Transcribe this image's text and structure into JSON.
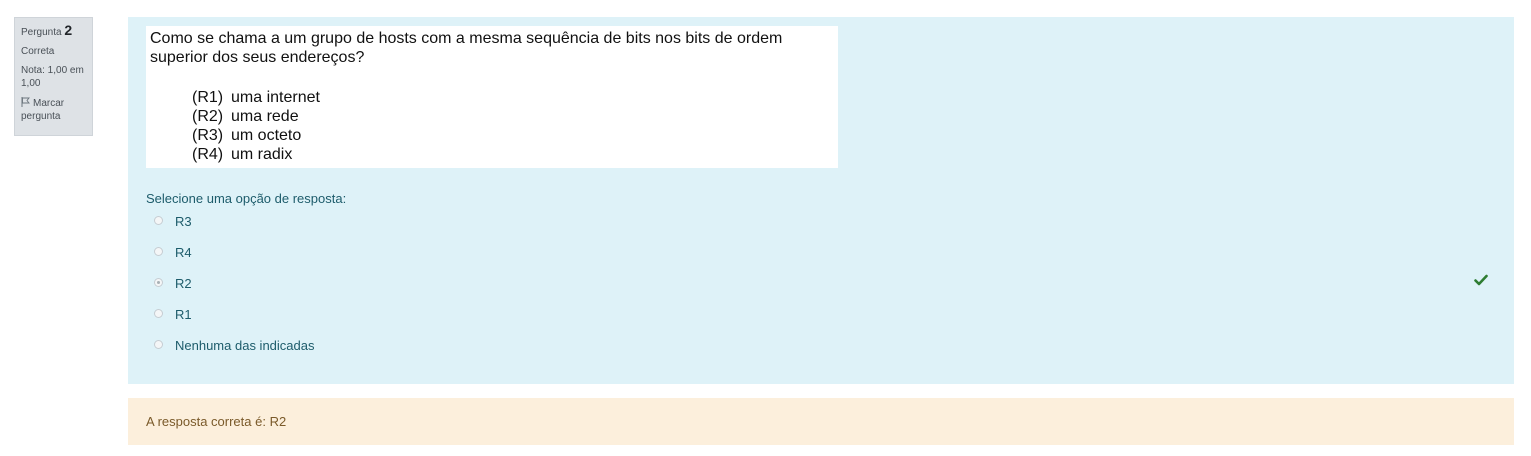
{
  "info": {
    "question_label": "Pergunta",
    "question_number": "2",
    "state": "Correta",
    "grade": "Nota: 1,00 em 1,00",
    "flag_label": "Marcar pergunta"
  },
  "question": {
    "text": "Como se chama a um grupo de hosts com a mesma sequência de bits nos bits de ordem superior dos seus endereços?",
    "options": [
      {
        "code": "(R1)",
        "text": "uma internet"
      },
      {
        "code": "(R2)",
        "text": "uma rede"
      },
      {
        "code": "(R3)",
        "text": "um octeto"
      },
      {
        "code": "(R4)",
        "text": "um radix"
      }
    ]
  },
  "prompt": "Selecione uma opção de resposta:",
  "answers": [
    {
      "label": "R3",
      "selected": false
    },
    {
      "label": "R4",
      "selected": false
    },
    {
      "label": "R2",
      "selected": true
    },
    {
      "label": "R1",
      "selected": false
    },
    {
      "label": "Nenhuma das indicadas",
      "selected": false
    }
  ],
  "feedback": "A resposta correta é: R2",
  "colors": {
    "content_bg": "#def2f8",
    "feedback_bg": "#fcefdc",
    "correct": "#2e7d32"
  },
  "icons": {
    "flag": "flag-icon",
    "correct": "check-icon"
  }
}
